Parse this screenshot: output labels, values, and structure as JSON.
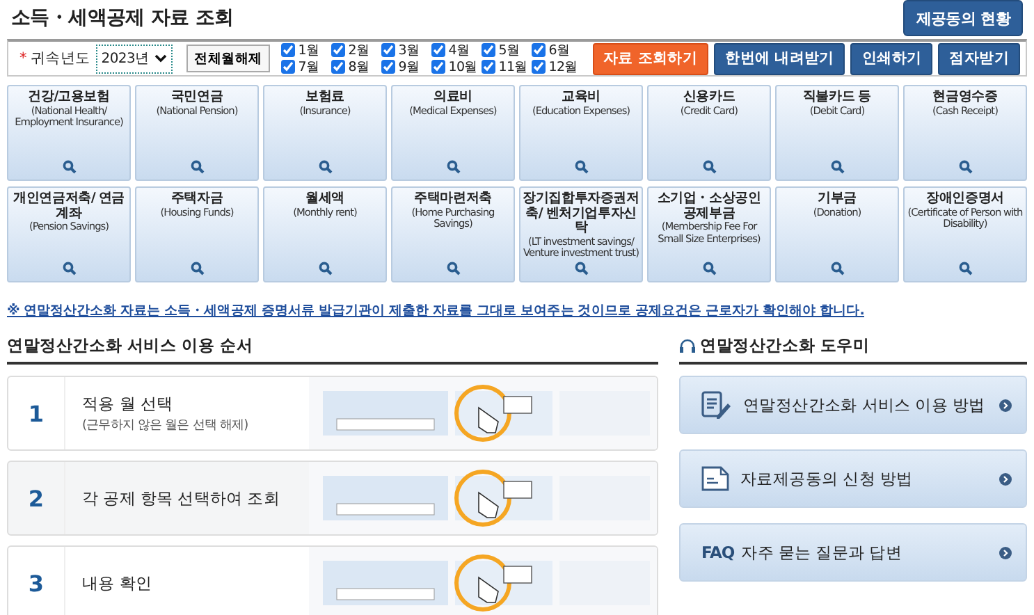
{
  "page_title": "소득・세액공제 자료 조회",
  "status_button": "제공동의 현황",
  "filter": {
    "required_mark": "*",
    "year_label": "귀속년도",
    "year": "2023년",
    "clear_button": "전체월해제",
    "months": [
      {
        "label": "1월",
        "checked": true
      },
      {
        "label": "2월",
        "checked": true
      },
      {
        "label": "3월",
        "checked": true
      },
      {
        "label": "4월",
        "checked": true
      },
      {
        "label": "5월",
        "checked": true
      },
      {
        "label": "6월",
        "checked": true
      },
      {
        "label": "7월",
        "checked": true
      },
      {
        "label": "8월",
        "checked": true
      },
      {
        "label": "9월",
        "checked": true
      },
      {
        "label": "10월",
        "checked": true
      },
      {
        "label": "11월",
        "checked": true
      },
      {
        "label": "12월",
        "checked": true
      }
    ],
    "actions": [
      {
        "label": "자료 조회하기",
        "kind": "primary"
      },
      {
        "label": "한번에 내려받기",
        "kind": "normal"
      },
      {
        "label": "인쇄하기",
        "kind": "normal"
      },
      {
        "label": "점자받기",
        "kind": "normal"
      }
    ]
  },
  "categories": [
    {
      "title": "건강/고용보험",
      "subtitle": "(National Health/ Employment Insurance)"
    },
    {
      "title": "국민연금",
      "subtitle": "(National Pension)"
    },
    {
      "title": "보험료",
      "subtitle": "(Insurance)"
    },
    {
      "title": "의료비",
      "subtitle": "(Medical Expenses)"
    },
    {
      "title": "교육비",
      "subtitle": "(Education Expenses)"
    },
    {
      "title": "신용카드",
      "subtitle": "(Credit Card)"
    },
    {
      "title": "직불카드 등",
      "subtitle": "(Debit Card)"
    },
    {
      "title": "현금영수증",
      "subtitle": "(Cash Receipt)"
    },
    {
      "title": "개인연금저축/ 연금계좌",
      "subtitle": "(Pension Savings)"
    },
    {
      "title": "주택자금",
      "subtitle": "(Housing Funds)"
    },
    {
      "title": "월세액",
      "subtitle": "(Monthly rent)"
    },
    {
      "title": "주택마련저축",
      "subtitle": "(Home Purchasing Savings)"
    },
    {
      "title": "장기집합투자증권저축/ 벤처기업투자신탁",
      "subtitle": "(LT investment savings/ Venture investment trust)"
    },
    {
      "title": "소기업・소상공인 공제부금",
      "subtitle": "(Membership Fee For Small Size Enterprises)"
    },
    {
      "title": "기부금",
      "subtitle": "(Donation)"
    },
    {
      "title": "장애인증명서",
      "subtitle": "(Certificate of Person with Disability)"
    }
  ],
  "notice": "※ 연말정산간소화 자료는 소득・세액공제 증명서류 발급기관이 제출한 자료를 그대로 보여주는 것이므로 공제요건은 근로자가 확인해야 합니다.",
  "guide": {
    "title": "연말정산간소화 서비스 이용 순서",
    "steps": [
      {
        "number": "1",
        "title": "적용 월 선택",
        "note": "(근무하지 않은 월은 선택 해제)"
      },
      {
        "number": "2",
        "title": "각 공제 항목 선택하여 조회"
      },
      {
        "number": "3",
        "title": "내용 확인"
      }
    ]
  },
  "helper": {
    "title": "연말정산간소화 도우미",
    "links": [
      {
        "label": "연말정산간소화 서비스 이용 방법",
        "kind": "form"
      },
      {
        "label": "자료제공동의 신청 방법",
        "kind": "document"
      },
      {
        "label": "자주 묻는 질문과 답변",
        "kind": "faq",
        "prefix": "FAQ"
      }
    ]
  }
}
